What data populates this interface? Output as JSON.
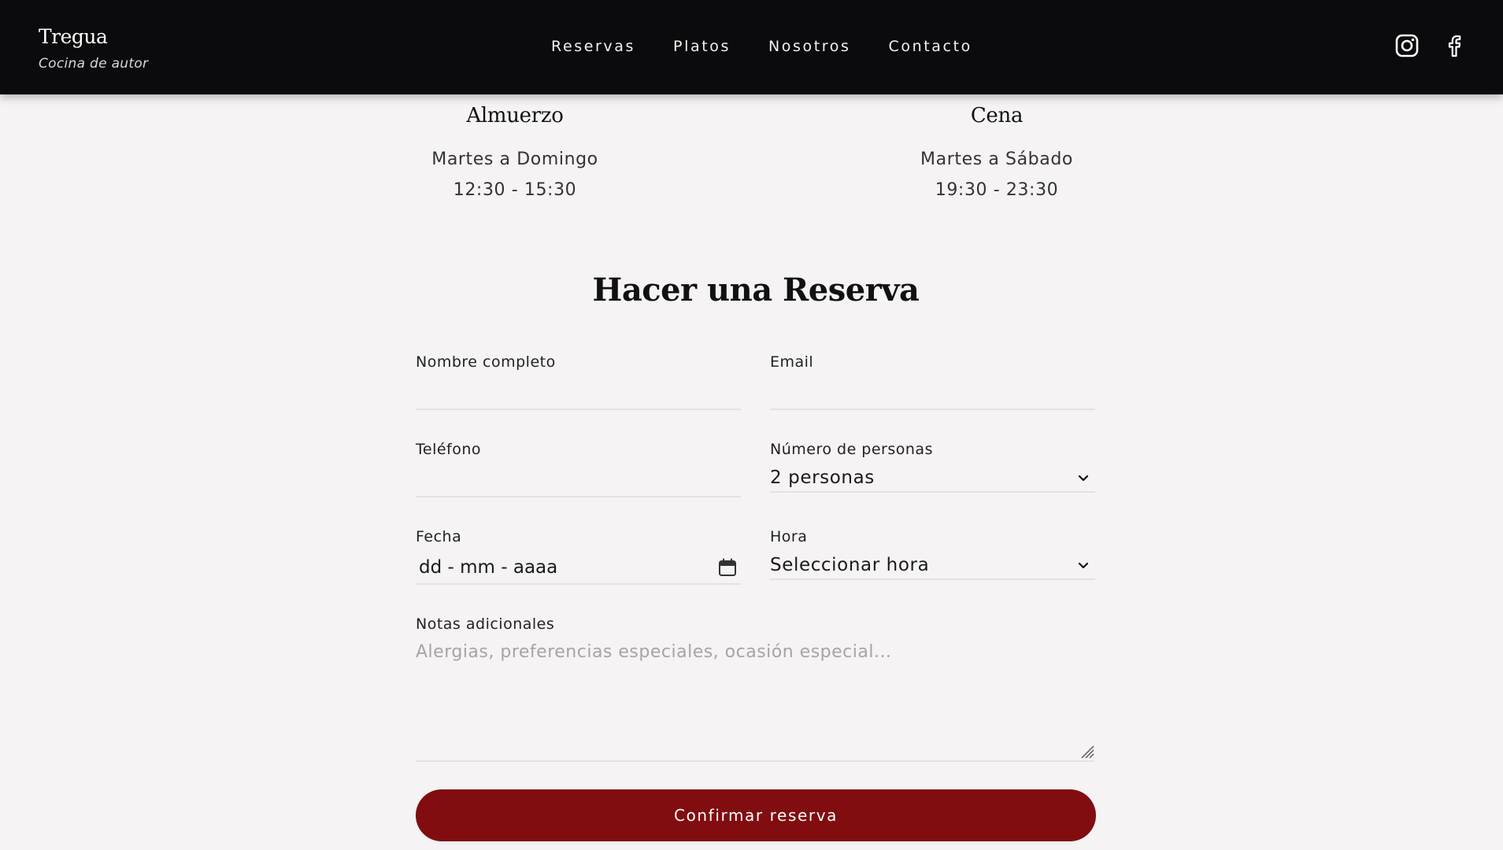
{
  "header": {
    "brand_name": "Tregua",
    "brand_tagline": "Cocina de autor",
    "nav": [
      "Reservas",
      "Platos",
      "Nosotros",
      "Contacto"
    ],
    "social_icons": [
      "instagram-icon",
      "facebook-icon"
    ]
  },
  "schedule": {
    "lunch": {
      "title": "Almuerzo",
      "days": "Martes a Domingo",
      "hours": "12:30 - 15:30"
    },
    "dinner": {
      "title": "Cena",
      "days": "Martes a Sábado",
      "hours": "19:30 - 23:30"
    }
  },
  "form": {
    "title": "Hacer una Reserva",
    "name_label": "Nombre completo",
    "name_value": "",
    "email_label": "Email",
    "email_value": "",
    "phone_label": "Teléfono",
    "phone_value": "",
    "people_label": "Número de personas",
    "people_selected": "2 personas",
    "date_label": "Fecha",
    "date_placeholder": "dd - mm - aaaa",
    "time_label": "Hora",
    "time_selected": "Seleccionar hora",
    "notes_label": "Notas adicionales",
    "notes_placeholder": "Alergias, preferencias especiales, ocasión especial...",
    "submit_label": "Confirmar reserva"
  },
  "colors": {
    "header_bg": "#0b0a0c",
    "page_bg": "#f5f3f4",
    "accent": "#810d10"
  }
}
